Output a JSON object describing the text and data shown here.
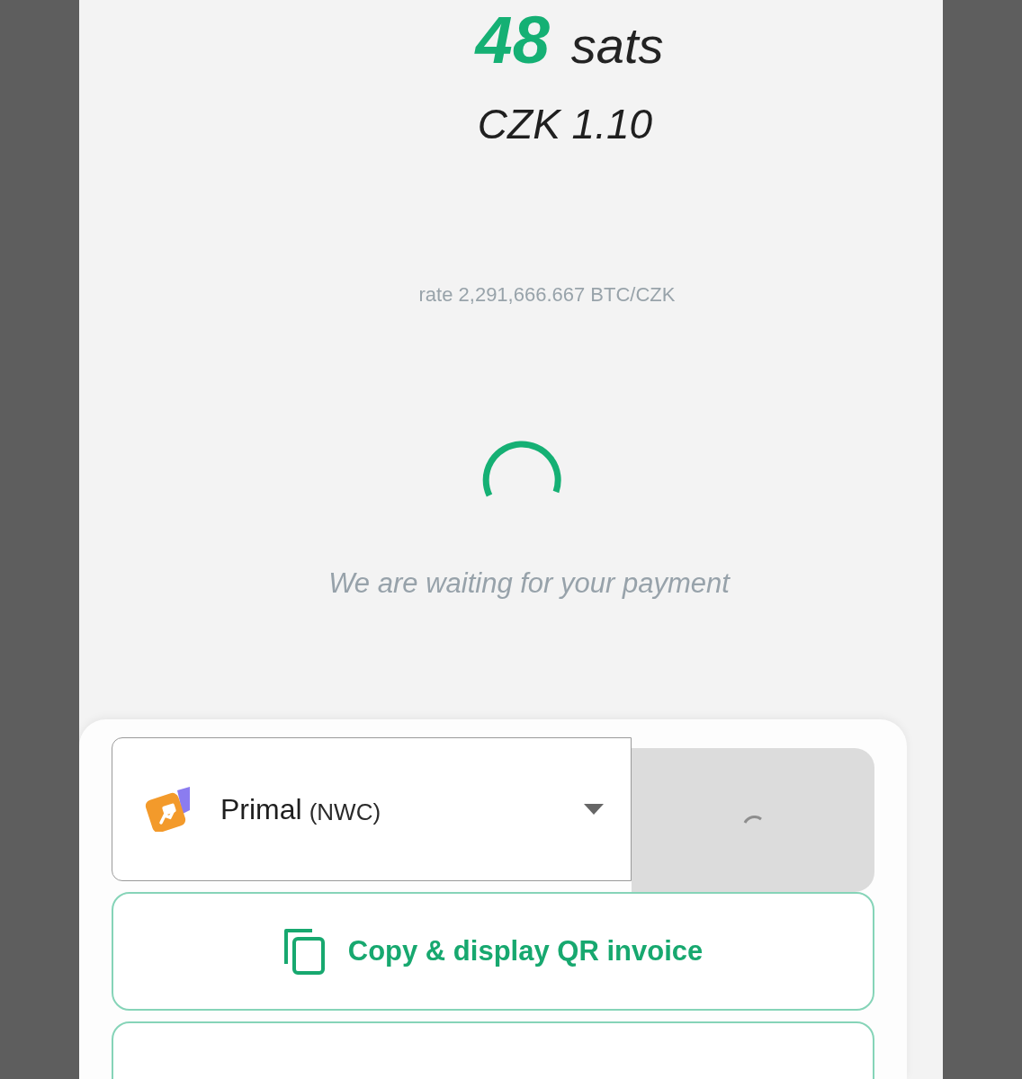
{
  "amount": {
    "value": "48",
    "unit": "sats"
  },
  "fiat": "CZK 1.10",
  "rate": "rate 2,291,666.667 BTC/CZK",
  "status": {
    "waiting": true,
    "message": "We are waiting for your payment"
  },
  "payment_sheet": {
    "wallet_select": {
      "name": "Primal",
      "type": "(NWC)",
      "expanded": false
    },
    "pay_button": {
      "loading": true
    },
    "buttons": [
      {
        "kind": "copy",
        "label": "Copy & display QR invoice"
      },
      {
        "kind": "blank"
      }
    ]
  }
}
